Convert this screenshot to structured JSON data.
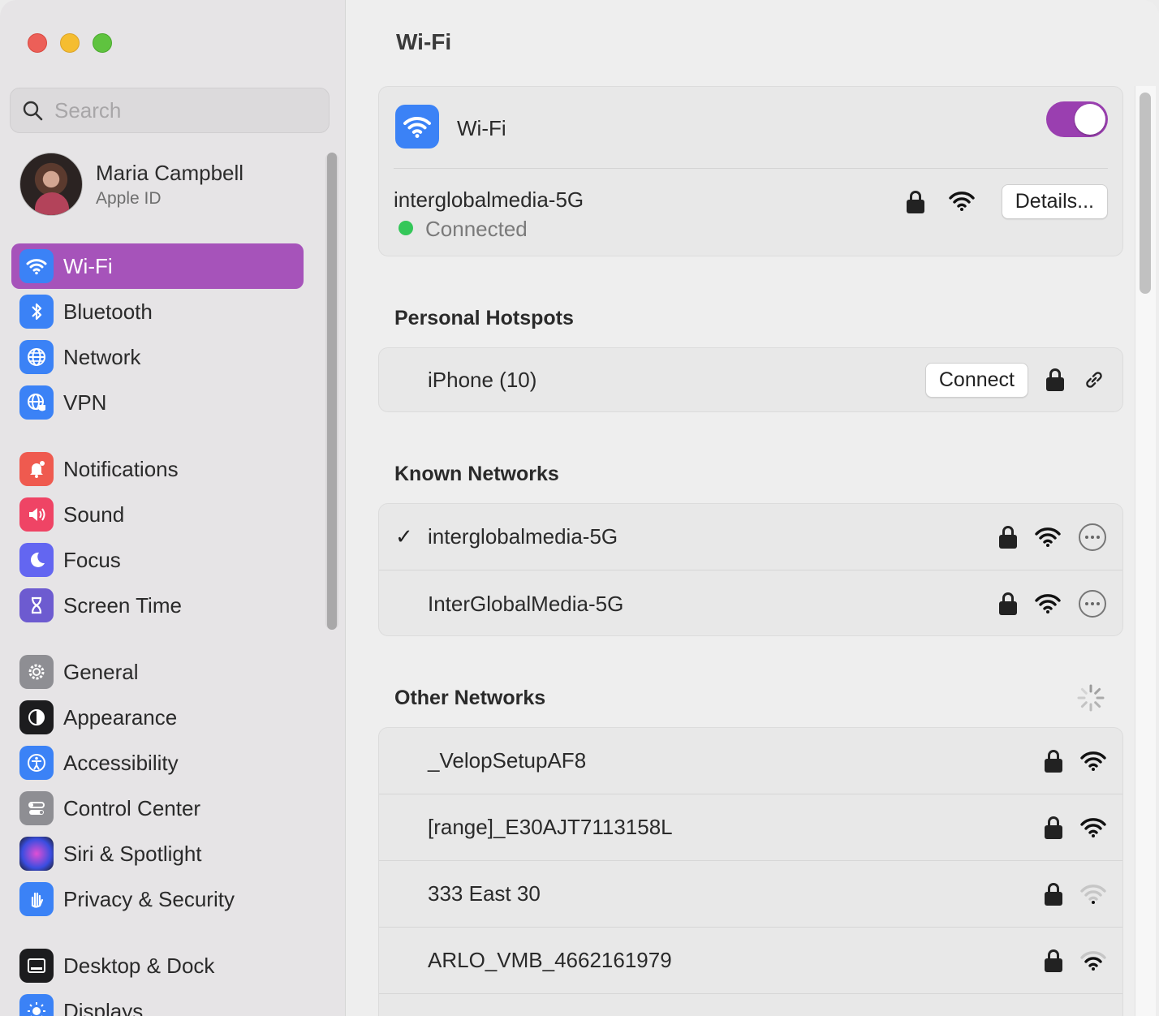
{
  "search": {
    "placeholder": "Search"
  },
  "profile": {
    "name": "Maria Campbell",
    "subtitle": "Apple ID"
  },
  "sidebar": {
    "items": [
      {
        "label": "Wi-Fi",
        "icon": "wifi-icon",
        "color": "#3b82f6",
        "active": true
      },
      {
        "label": "Bluetooth",
        "icon": "bluetooth-icon",
        "color": "#3b82f6"
      },
      {
        "label": "Network",
        "icon": "globe-icon",
        "color": "#3b82f6"
      },
      {
        "label": "VPN",
        "icon": "vpn-globe-icon",
        "color": "#3b82f6"
      },
      {
        "label": "Notifications",
        "icon": "bell-icon",
        "color": "#ef4444"
      },
      {
        "label": "Sound",
        "icon": "speaker-icon",
        "color": "#ef4465"
      },
      {
        "label": "Focus",
        "icon": "moon-icon",
        "color": "#6366f1"
      },
      {
        "label": "Screen Time",
        "icon": "hourglass-icon",
        "color": "#6d5bd0"
      },
      {
        "label": "General",
        "icon": "gear-icon",
        "color": "#8e8e93"
      },
      {
        "label": "Appearance",
        "icon": "appearance-icon",
        "color": "#1c1c1e"
      },
      {
        "label": "Accessibility",
        "icon": "accessibility-icon",
        "color": "#3b82f6"
      },
      {
        "label": "Control Center",
        "icon": "control-center-icon",
        "color": "#8e8e93"
      },
      {
        "label": "Siri & Spotlight",
        "icon": "siri-icon",
        "color": "#444"
      },
      {
        "label": "Privacy & Security",
        "icon": "hand-icon",
        "color": "#3b82f6"
      },
      {
        "label": "Desktop & Dock",
        "icon": "dock-icon",
        "color": "#1c1c1e"
      },
      {
        "label": "Displays",
        "icon": "sun-icon",
        "color": "#3b82f6"
      }
    ]
  },
  "main": {
    "title": "Wi-Fi",
    "wifi_label": "Wi-Fi",
    "wifi_on": true,
    "current_network": {
      "name": "interglobalmedia-5G",
      "status": "Connected",
      "details_label": "Details..."
    },
    "hotspots": {
      "title": "Personal Hotspots",
      "items": [
        {
          "name": "iPhone (10)",
          "connect_label": "Connect"
        }
      ]
    },
    "known": {
      "title": "Known Networks",
      "items": [
        {
          "name": "interglobalmedia-5G",
          "checked": true
        },
        {
          "name": "InterGlobalMedia-5G",
          "checked": false
        }
      ]
    },
    "other": {
      "title": "Other Networks",
      "items": [
        {
          "name": "_VelopSetupAF8",
          "signal": "strong"
        },
        {
          "name": "[range]_E30AJT7113158L",
          "signal": "strong"
        },
        {
          "name": "333 East 30",
          "signal": "weak"
        },
        {
          "name": "ARLO_VMB_4662161979",
          "signal": "medium"
        }
      ]
    }
  },
  "colors": {
    "accent": "#a653ba",
    "toggle": "#9a3fb0",
    "connected": "#34c759"
  }
}
